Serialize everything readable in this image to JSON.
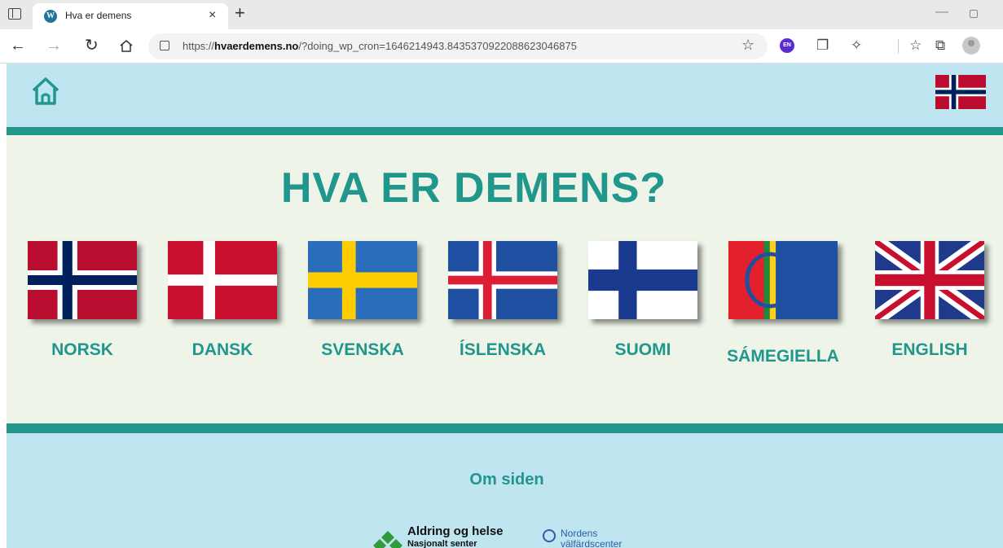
{
  "browser": {
    "tab_title": "Hva er demens",
    "tab_close": "×",
    "new_tab": "+",
    "url_host": "hvaerdemens.no",
    "url_prefix": "https://",
    "url_path": "/?doing_wp_cron=1646214943.8435370922088623046875",
    "extension_label": "EN",
    "icons": [
      "back-icon",
      "forward-icon",
      "refresh-icon",
      "home-icon",
      "lock-icon",
      "favorites-star-icon",
      "extension-icon",
      "collections-icon",
      "favorites-bar-icon",
      "profile-icon"
    ]
  },
  "header": {
    "home_icon": "home-icon",
    "language_flag": "norway-flag"
  },
  "main": {
    "title": "HVA ER DEMENS?",
    "languages": [
      {
        "label": "NORSK",
        "flag": "norway-flag"
      },
      {
        "label": "DANSK",
        "flag": "denmark-flag"
      },
      {
        "label": "SVENSKA",
        "flag": "sweden-flag"
      },
      {
        "label": "ÍSLENSKA",
        "flag": "iceland-flag"
      },
      {
        "label": "SUOMI",
        "flag": "finland-flag"
      },
      {
        "label": "SÁMEGIELLA",
        "flag": "sami-flag"
      },
      {
        "label": "ENGLISH",
        "flag": "uk-flag"
      }
    ]
  },
  "footer": {
    "about_link": "Om siden",
    "logos": {
      "aldring_line1": "Aldring og helse",
      "aldring_line2": "Nasjonalt senter",
      "nordens_line1": "Nordens",
      "nordens_line2": "välfärdscenter"
    }
  },
  "colors": {
    "teal": "#25968c",
    "header_bg": "#bee5f0",
    "main_bg": "#eef5e8"
  }
}
